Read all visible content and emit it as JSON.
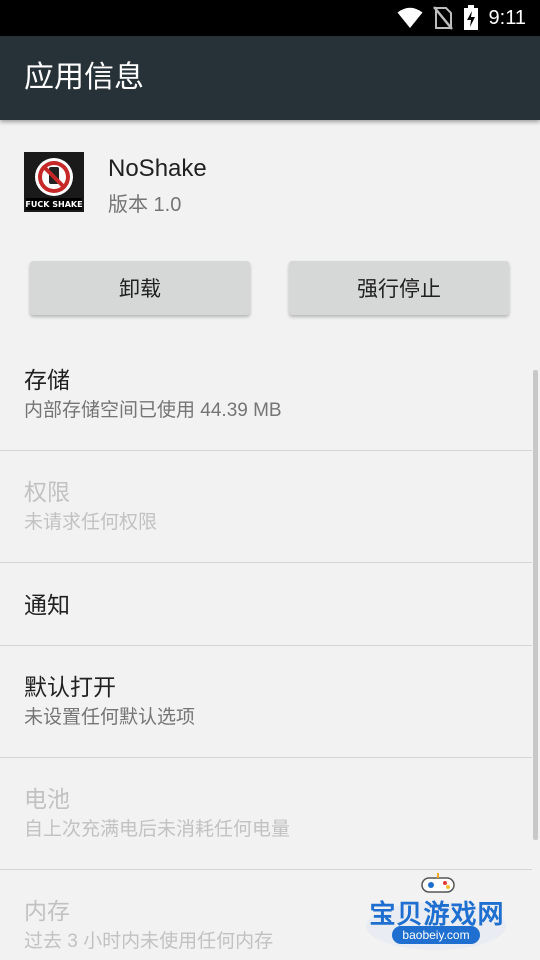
{
  "status_bar": {
    "time": "9:11"
  },
  "app_bar": {
    "title": "应用信息"
  },
  "app": {
    "name": "NoShake",
    "version": "版本 1.0",
    "icon_text": "FUCK SHAKE"
  },
  "buttons": {
    "uninstall": "卸载",
    "force_stop": "强行停止"
  },
  "rows": [
    {
      "label": "存储",
      "sub": "内部存储空间已使用 44.39 MB",
      "enabled": true
    },
    {
      "label": "权限",
      "sub": "未请求任何权限",
      "enabled": false
    },
    {
      "label": "通知",
      "sub": "",
      "enabled": true
    },
    {
      "label": "默认打开",
      "sub": "未设置任何默认选项",
      "enabled": true
    },
    {
      "label": "电池",
      "sub": "自上次充满电后未消耗任何电量",
      "enabled": false
    },
    {
      "label": "内存",
      "sub": "过去 3 小时内未使用任何内存",
      "enabled": false
    }
  ],
  "watermark": {
    "title": "宝贝游戏网",
    "url": "baobeiy.com"
  },
  "colors": {
    "app_bar": "#263238",
    "background": "#f2f2f2",
    "button": "#d6d7d7",
    "watermark_blue": "#1e6fd0"
  }
}
